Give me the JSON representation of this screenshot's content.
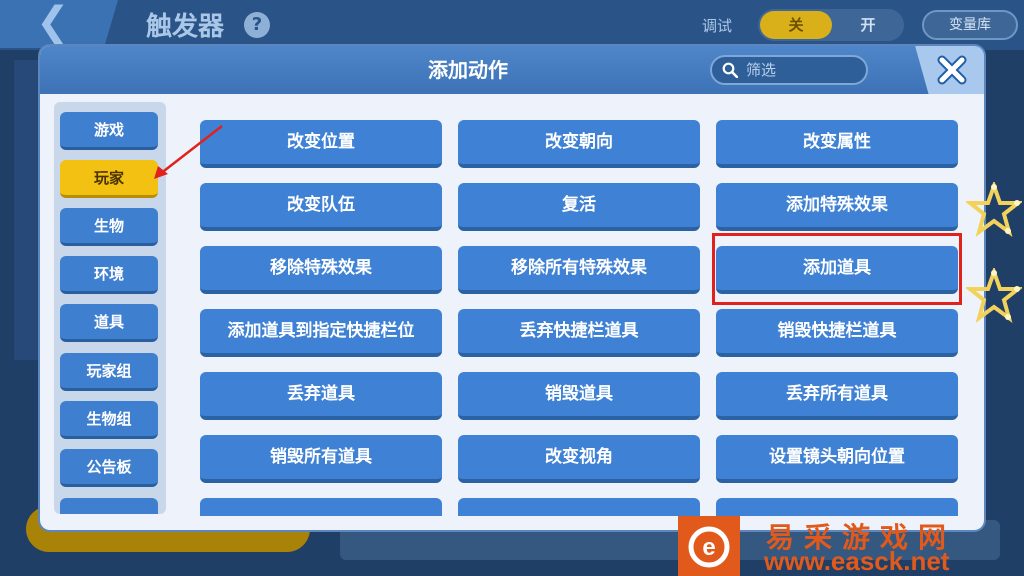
{
  "background": {
    "title": "触发器",
    "debug_label": "调试",
    "toggle_off": "关",
    "toggle_on": "开",
    "variable_library": "变量库"
  },
  "dialog": {
    "title": "添加动作",
    "filter_placeholder": "筛选"
  },
  "categories": [
    {
      "label": "游戏",
      "selected": false
    },
    {
      "label": "玩家",
      "selected": true
    },
    {
      "label": "生物",
      "selected": false
    },
    {
      "label": "环境",
      "selected": false
    },
    {
      "label": "道具",
      "selected": false
    },
    {
      "label": "玩家组",
      "selected": false
    },
    {
      "label": "生物组",
      "selected": false
    },
    {
      "label": "公告板",
      "selected": false
    }
  ],
  "actions": [
    "改变位置",
    "改变朝向",
    "改变属性",
    "改变队伍",
    "复活",
    "添加特殊效果",
    "移除特殊效果",
    "移除所有特殊效果",
    "添加道具",
    "添加道具到指定快捷栏位",
    "丢弃快捷栏道具",
    "销毁快捷栏道具",
    "丢弃道具",
    "销毁道具",
    "丢弃所有道具",
    "销毁所有道具",
    "改变视角",
    "设置镜头朝向位置"
  ],
  "highlighted_action": "添加道具",
  "watermark": {
    "cn": "易采游戏网",
    "url": "www.easck.net"
  },
  "colors": {
    "button_blue": "#3f81d4",
    "selected_yellow": "#f3c111",
    "highlight_red": "#e0211c",
    "watermark_orange": "#e25a1b"
  }
}
